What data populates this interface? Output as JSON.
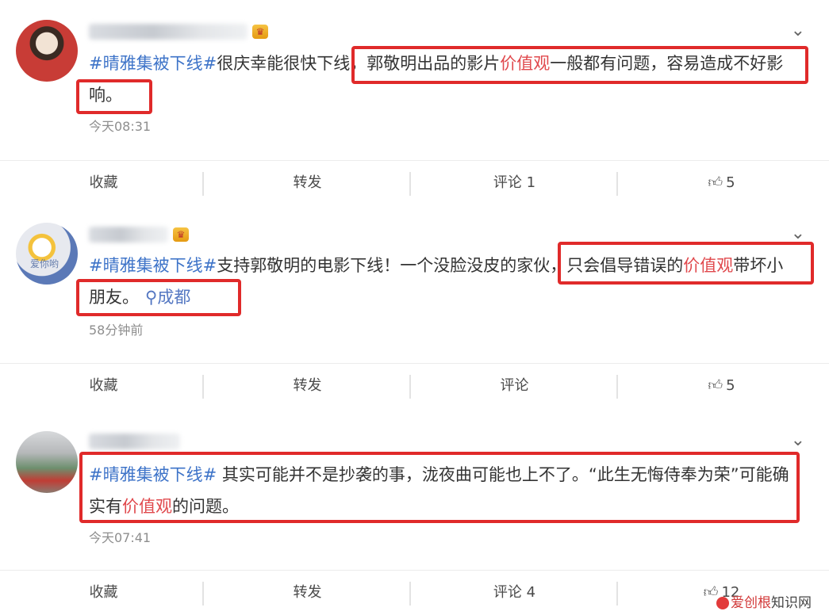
{
  "posts": [
    {
      "hashtag": "#晴雅集被下线#",
      "text_before": "很庆幸能很快下线，",
      "text_boxed_1": "郭敬明出品的影片",
      "highlight": "价值观",
      "text_boxed_2": "一般都有问题，容易造成不好影",
      "text_line2": "响。",
      "time": "今天08:31",
      "actions": {
        "favorite": "收藏",
        "repost": "转发",
        "comment": "评论 1",
        "like_count": "5"
      }
    },
    {
      "avatar_text": "爱你哟",
      "hashtag": "#晴雅集被下线#",
      "text_before": "支持郭敬明的电影下线！一个没脸没皮的家伙，",
      "text_boxed_1": "只会倡导错误的",
      "highlight": "价值观",
      "text_boxed_2": "带坏小",
      "text_line2": "朋友。",
      "location": "成都",
      "time": "58分钟前",
      "actions": {
        "favorite": "收藏",
        "repost": "转发",
        "comment": "评论",
        "like_count": "5"
      }
    },
    {
      "hashtag": "#晴雅集被下线#",
      "text_1": " 其实可能并不是抄袭的事，泷夜曲可能也上不了。“此生无悔侍奉为荣”可能确",
      "text_line2_before": "实有",
      "highlight": "价值观",
      "text_line2_after": "的问题。",
      "time": "今天07:41",
      "actions": {
        "favorite": "收藏",
        "repost": "转发",
        "comment": "评论 4",
        "like_count": "12"
      }
    }
  ],
  "icons": {
    "chevron": "chevron-down-icon",
    "like": "thumbs-up-icon",
    "location": "location-pin-icon",
    "crown": "crown-icon"
  },
  "watermark": {
    "part1": "爱创根",
    "part2": "知识网"
  },
  "colors": {
    "hashtag": "#3d73c8",
    "highlight": "#e0484c",
    "box": "#e02a2a"
  }
}
